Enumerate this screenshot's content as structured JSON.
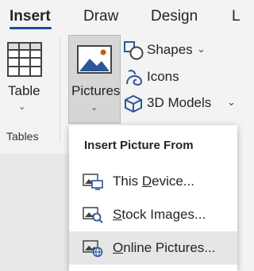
{
  "tabs": [
    {
      "label": "Insert",
      "active": true
    },
    {
      "label": "Draw",
      "active": false
    },
    {
      "label": "Design",
      "active": false
    },
    {
      "label": "L",
      "active": false
    }
  ],
  "ribbon": {
    "table_label": "Table",
    "tables_group_label": "Tables",
    "pictures_label": "Pictures",
    "shapes_label": "Shapes",
    "icons_label": "Icons",
    "models_label": "3D Models",
    "accent_color": "#1f4e9e"
  },
  "menu": {
    "title": "Insert Picture From",
    "items": [
      {
        "pre": "This ",
        "key": "D",
        "post": "evice...",
        "icon": "device-picture-icon"
      },
      {
        "pre": "",
        "key": "S",
        "post": "tock Images...",
        "icon": "stock-images-icon"
      },
      {
        "pre": "",
        "key": "O",
        "post": "nline Pictures...",
        "icon": "online-pictures-icon",
        "hovered": true
      }
    ]
  }
}
